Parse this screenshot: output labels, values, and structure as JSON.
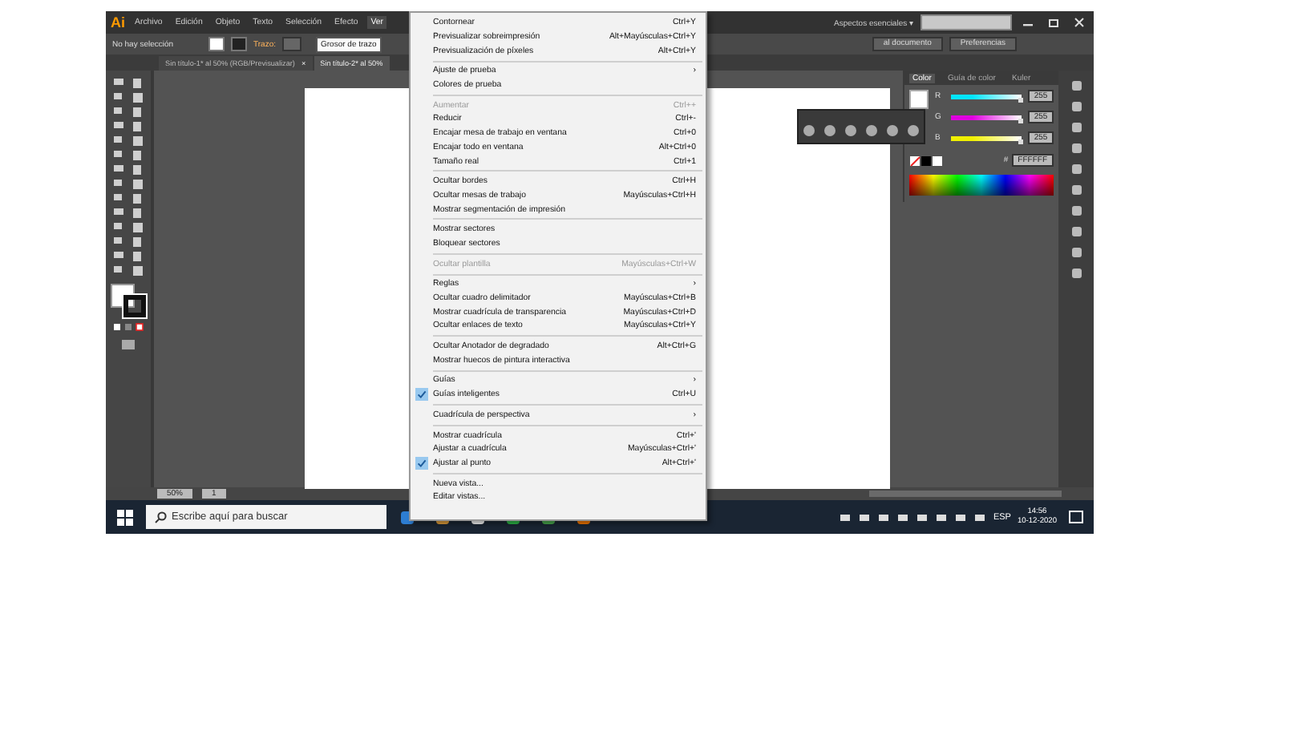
{
  "menubar": {
    "logo": "Ai",
    "items": [
      {
        "label": "Archivo",
        "selected": false
      },
      {
        "label": "Edición",
        "selected": false
      },
      {
        "label": "Objeto",
        "selected": false
      },
      {
        "label": "Texto",
        "selected": false
      },
      {
        "label": "Selección",
        "selected": false
      },
      {
        "label": "Efecto",
        "selected": false
      },
      {
        "label": "Ver",
        "selected": true
      }
    ],
    "workspace": "Aspectos esenciales",
    "workspace_caret": "▾"
  },
  "control_bar": {
    "selection": "No hay selección",
    "stroke_label": "Trazo:",
    "tooltip": "Grosor de trazo",
    "buttons": [
      "al documento",
      "Preferencias"
    ]
  },
  "doc_tabs": [
    {
      "label": "Sin título-1* al 50% (RGB/Previsualizar)",
      "close": "×",
      "selected": false
    },
    {
      "label": "Sin título-2* al 50%",
      "selected": true
    }
  ],
  "menu": [
    {
      "kind": "item",
      "label": "Contornear",
      "shortcut": "Ctrl+Y",
      "disabled": false,
      "checked": false
    },
    {
      "kind": "item",
      "label": "Previsualizar sobreimpresión",
      "shortcut": "Alt+Mayúsculas+Ctrl+Y",
      "disabled": false,
      "checked": false
    },
    {
      "kind": "item",
      "label": "Previsualización de píxeles",
      "shortcut": "Alt+Ctrl+Y",
      "disabled": false,
      "checked": false
    },
    {
      "kind": "separator"
    },
    {
      "kind": "item",
      "label": "Ajuste de prueba",
      "submenu": "›",
      "disabled": false,
      "checked": false
    },
    {
      "kind": "item",
      "label": "Colores de prueba",
      "disabled": false,
      "checked": false
    },
    {
      "kind": "separator"
    },
    {
      "kind": "item",
      "label": "Aumentar",
      "shortcut": "Ctrl++",
      "disabled": true,
      "checked": false
    },
    {
      "kind": "item",
      "label": "Reducir",
      "shortcut": "Ctrl+-",
      "disabled": false,
      "checked": false
    },
    {
      "kind": "item",
      "label": "Encajar mesa de trabajo en ventana",
      "shortcut": "Ctrl+0",
      "disabled": false,
      "checked": false
    },
    {
      "kind": "item",
      "label": "Encajar todo en ventana",
      "shortcut": "Alt+Ctrl+0",
      "disabled": false,
      "checked": false
    },
    {
      "kind": "item",
      "label": "Tamaño real",
      "shortcut": "Ctrl+1",
      "disabled": false,
      "checked": false
    },
    {
      "kind": "separator"
    },
    {
      "kind": "item",
      "label": "Ocultar bordes",
      "shortcut": "Ctrl+H",
      "disabled": false,
      "checked": false
    },
    {
      "kind": "item",
      "label": "Ocultar mesas de trabajo",
      "shortcut": "Mayúsculas+Ctrl+H",
      "disabled": false,
      "checked": false
    },
    {
      "kind": "item",
      "label": "Mostrar segmentación de impresión",
      "disabled": false,
      "checked": false
    },
    {
      "kind": "separator"
    },
    {
      "kind": "item",
      "label": "Mostrar sectores",
      "disabled": false,
      "checked": false
    },
    {
      "kind": "item",
      "label": "Bloquear sectores",
      "disabled": false,
      "checked": false
    },
    {
      "kind": "separator"
    },
    {
      "kind": "item",
      "label": "Ocultar plantilla",
      "shortcut": "Mayúsculas+Ctrl+W",
      "disabled": true,
      "checked": false
    },
    {
      "kind": "separator"
    },
    {
      "kind": "item",
      "label": "Reglas",
      "submenu": "›",
      "disabled": false,
      "checked": false
    },
    {
      "kind": "item",
      "label": "Ocultar cuadro delimitador",
      "shortcut": "Mayúsculas+Ctrl+B",
      "disabled": false,
      "checked": false
    },
    {
      "kind": "item",
      "label": "Mostrar cuadrícula de transparencia",
      "shortcut": "Mayúsculas+Ctrl+D",
      "disabled": false,
      "checked": false
    },
    {
      "kind": "item",
      "label": "Ocultar enlaces de texto",
      "shortcut": "Mayúsculas+Ctrl+Y",
      "disabled": false,
      "checked": false
    },
    {
      "kind": "separator"
    },
    {
      "kind": "item",
      "label": "Ocultar Anotador de degradado",
      "shortcut": "Alt+Ctrl+G",
      "disabled": false,
      "checked": false
    },
    {
      "kind": "item",
      "label": "Mostrar huecos de pintura interactiva",
      "disabled": false,
      "checked": false
    },
    {
      "kind": "separator"
    },
    {
      "kind": "item",
      "label": "Guías",
      "submenu": "›",
      "disabled": false,
      "checked": false
    },
    {
      "kind": "item",
      "label": "Guías inteligentes",
      "shortcut": "Ctrl+U",
      "disabled": false,
      "checked": true
    },
    {
      "kind": "separator"
    },
    {
      "kind": "item",
      "label": "Cuadrícula de perspectiva",
      "submenu": "›",
      "disabled": false,
      "checked": false
    },
    {
      "kind": "separator"
    },
    {
      "kind": "item",
      "label": "Mostrar cuadrícula",
      "shortcut": "Ctrl+'",
      "disabled": false,
      "checked": false
    },
    {
      "kind": "item",
      "label": "Ajustar a cuadrícula",
      "shortcut": "Mayúsculas+Ctrl+'",
      "disabled": false,
      "checked": false
    },
    {
      "kind": "item",
      "label": "Ajustar al punto",
      "shortcut": "Alt+Ctrl+'",
      "disabled": false,
      "checked": true
    },
    {
      "kind": "separator"
    },
    {
      "kind": "item",
      "label": "Nueva vista...",
      "disabled": false,
      "checked": false
    },
    {
      "kind": "item",
      "label": "Editar vistas...",
      "disabled": false,
      "checked": false
    }
  ],
  "color_panel": {
    "tabs": [
      {
        "label": "Color",
        "selected": true
      },
      {
        "label": "Guía de color",
        "selected": false
      },
      {
        "label": "Kuler",
        "selected": false
      }
    ],
    "channels": [
      {
        "name": "R",
        "value": "255",
        "level": 1,
        "color": "#00e5ff"
      },
      {
        "name": "G",
        "value": "255",
        "level": 1,
        "color": "#e000e0"
      },
      {
        "name": "B",
        "value": "255",
        "level": 1,
        "color": "#f0f000"
      }
    ],
    "hex_prefix": "#",
    "hex": "FFFFFF"
  },
  "status_bar": {
    "zoom": "50%",
    "page": "1"
  },
  "taskbar": {
    "search_placeholder": "Escribe aquí para buscar",
    "language": "ESP",
    "time": "14:56",
    "date": "10-12-2020"
  }
}
